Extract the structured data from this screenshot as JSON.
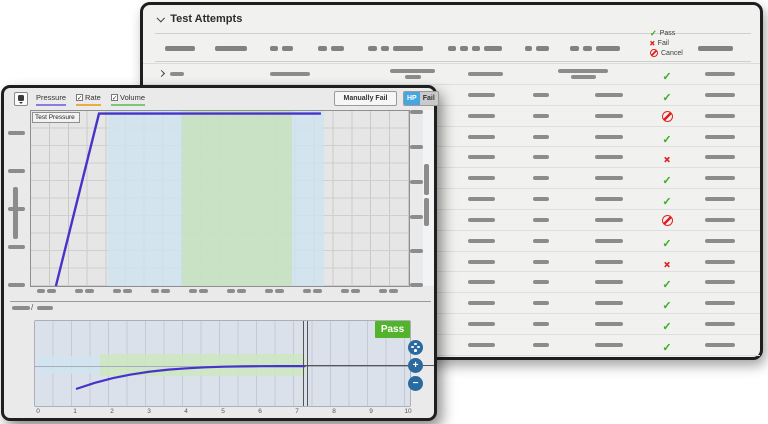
{
  "back_panel": {
    "title": "Test Attempts",
    "legend": [
      {
        "status": "pass",
        "label": "Pass"
      },
      {
        "status": "fail",
        "label": "Fail"
      },
      {
        "status": "cancel",
        "label": "Cancel"
      }
    ],
    "columns_redacted": true,
    "rows": [
      {
        "expandable": true,
        "status": "pass"
      },
      {
        "status": "pass"
      },
      {
        "status": "cancel"
      },
      {
        "status": "pass"
      },
      {
        "status": "fail"
      },
      {
        "status": "pass"
      },
      {
        "status": "pass"
      },
      {
        "status": "cancel"
      },
      {
        "status": "pass"
      },
      {
        "status": "fail"
      },
      {
        "status": "pass"
      },
      {
        "status": "pass"
      },
      {
        "status": "pass"
      },
      {
        "status": "pass"
      }
    ]
  },
  "front_panel": {
    "toolbar": {
      "pressure_label": "Pressure",
      "rate_label": "Rate",
      "volume_label": "Volume",
      "rate_checked": true,
      "volume_checked": true,
      "manually_fail_label": "Manually Fail",
      "hp_label": "HP",
      "fail_label": "Fail",
      "series_colors": {
        "pressure": "#8d7ae0",
        "rate": "#ecab3f",
        "volume": "#7cc579"
      }
    },
    "main_chart": {
      "series_box_label": "Test Pressure",
      "axis_labels_redacted": true
    },
    "divider": {
      "slash": "/",
      "labels_redacted": true
    },
    "result_badge": "Pass",
    "zoom_buttons": [
      {
        "name": "reset-view-button",
        "glyph": ""
      },
      {
        "name": "zoom-in-button",
        "glyph": "+"
      },
      {
        "name": "zoom-out-button",
        "glyph": "−"
      }
    ],
    "status_colors": {
      "pass_green": "#3fae2a",
      "fail_red": "#e02020",
      "badge_green": "#54b32c",
      "line_purple": "#4733c9"
    }
  },
  "chart_data": [
    {
      "type": "line",
      "title": "Test Pressure",
      "note": "axis tick labels are redacted gray bars",
      "series": [
        {
          "name": "Test Pressure",
          "points_norm": [
            [
              0.066,
              0.0
            ],
            [
              0.18,
              0.985
            ],
            [
              0.767,
              0.985
            ]
          ]
        }
      ],
      "bands": [
        {
          "color": "#cfe4f0",
          "x_norm": [
            0.204,
            0.775
          ]
        },
        {
          "color": "#c6e0ba",
          "x_norm": [
            0.399,
            0.69
          ]
        }
      ],
      "grid": true,
      "legend_position": "top-left-in-plot"
    },
    {
      "type": "line",
      "x_ticks": [
        "0",
        "1",
        "2",
        "3",
        "4",
        "5",
        "6",
        "7",
        "8",
        "9",
        "10"
      ],
      "xlim": [
        0,
        10
      ],
      "series": [
        {
          "name": "approach-curve",
          "y_units": "normalized",
          "points": [
            [
              1,
              0.2
            ],
            [
              1.5,
              0.272
            ],
            [
              2,
              0.328
            ],
            [
              2.5,
              0.372
            ],
            [
              3,
              0.405
            ],
            [
              3.5,
              0.428
            ],
            [
              4,
              0.444
            ],
            [
              4.5,
              0.455
            ],
            [
              5,
              0.462
            ],
            [
              5.5,
              0.466
            ],
            [
              6,
              0.468
            ],
            [
              6.5,
              0.469
            ],
            [
              7.2,
              0.47
            ]
          ]
        }
      ],
      "setpoint_y_norm": 0.47,
      "marker_x": 7.2,
      "bands": [
        {
          "color": "#cfe4f1",
          "x": [
            0,
            1.65
          ],
          "y_norm": [
            0.376,
            0.59
          ]
        },
        {
          "color": "#cde7c1",
          "x": [
            1.65,
            7.2
          ],
          "y_norm": [
            0.35,
            0.61
          ]
        }
      ],
      "result": "Pass"
    }
  ]
}
